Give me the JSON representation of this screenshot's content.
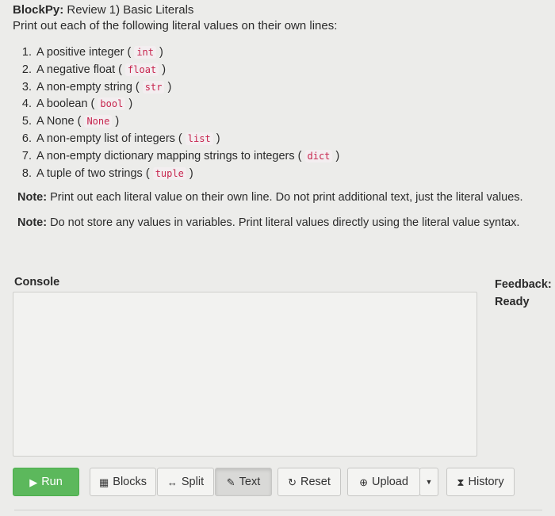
{
  "header": {
    "brand": "BlockPy:",
    "title": "Review 1) Basic Literals"
  },
  "instruction": "Print out each of the following literal values on their own lines:",
  "tasks": [
    {
      "text": "A positive integer ( ",
      "code": "int",
      "end": " )"
    },
    {
      "text": "A negative float ( ",
      "code": "float",
      "end": " )"
    },
    {
      "text": "A non-empty string ( ",
      "code": "str",
      "end": " )"
    },
    {
      "text": "A boolean ( ",
      "code": "bool",
      "end": " )"
    },
    {
      "text": "A None ( ",
      "code": "None",
      "end": " )"
    },
    {
      "text": "A non-empty list of integers ( ",
      "code": "list",
      "end": " )"
    },
    {
      "text": "A non-empty dictionary mapping strings to integers ( ",
      "code": "dict",
      "end": " )"
    },
    {
      "text": "A tuple of two strings ( ",
      "code": "tuple",
      "end": " )"
    }
  ],
  "notes": [
    {
      "label": "Note:",
      "text": " Print out each literal value on their own line. Do not print additional text, just the literal values."
    },
    {
      "label": "Note:",
      "text": " Do not store any values in variables. Print literal values directly using the literal value syntax."
    }
  ],
  "console": {
    "label": "Console",
    "content": ""
  },
  "feedback": {
    "label": "Feedback:",
    "status": "Ready"
  },
  "toolbar": {
    "run": "Run",
    "blocks": "Blocks",
    "split": "Split",
    "text": "Text",
    "reset": "Reset",
    "upload": "Upload",
    "history": "History"
  },
  "icons": {
    "run": "play-icon",
    "blocks": "grid-icon",
    "split": "left-right-arrow-icon",
    "text": "pencil-icon",
    "reset": "refresh-icon",
    "upload": "upload-circle-icon",
    "dropdown": "caret-down-icon",
    "history": "hourglass-icon"
  }
}
